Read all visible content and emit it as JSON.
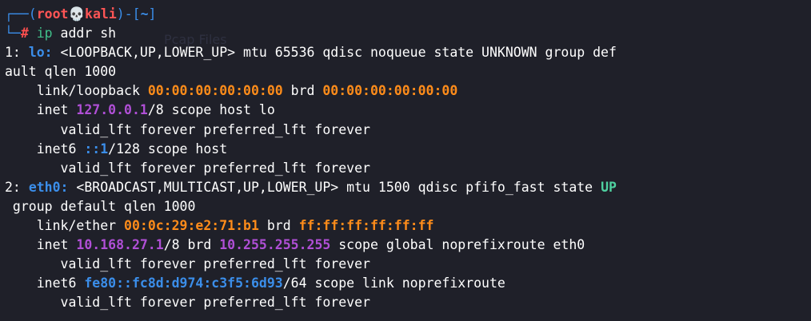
{
  "prompt": {
    "top_left": "┌──(",
    "user": "root",
    "skull": "💀",
    "host": "kali",
    "mid": ")-[",
    "path": "~",
    "end": "]",
    "bottom_left": "└─",
    "hash": "# ",
    "command": "ip",
    "args": " addr sh"
  },
  "ghost_text": "Pcap Files",
  "output": {
    "l1_pre": "1: ",
    "l1_if": "lo:",
    "l1_rest": " <LOOPBACK,UP,LOWER_UP> mtu 65536 qdisc noqueue state UNKNOWN group def",
    "l2": "ault qlen 1000",
    "l3_pre": "    link/loopback ",
    "l3_mac": "00:00:00:00:00:00",
    "l3_mid": " brd ",
    "l3_brd": "00:00:00:00:00:00",
    "l4_pre": "    inet ",
    "l4_ip": "127.0.0.1",
    "l4_rest": "/8 scope host lo",
    "l5": "       valid_lft forever preferred_lft forever",
    "l6_pre": "    inet6 ",
    "l6_ip": "::1",
    "l6_rest": "/128 scope host",
    "l7": "       valid_lft forever preferred_lft forever",
    "l8_pre": "2: ",
    "l8_if": "eth0:",
    "l8_rest": " <BROADCAST,MULTICAST,UP,LOWER_UP> mtu 1500 qdisc pfifo_fast state ",
    "l8_state": "UP",
    "l9": " group default qlen 1000",
    "l10_pre": "    link/ether ",
    "l10_mac": "00:0c:29:e2:71:b1",
    "l10_mid": " brd ",
    "l10_brd": "ff:ff:ff:ff:ff:ff",
    "l11_pre": "    inet ",
    "l11_ip": "10.168.27.1",
    "l11_mid": "/8 brd ",
    "l11_brd": "10.255.255.255",
    "l11_rest": " scope global noprefixroute eth0",
    "l12": "       valid_lft forever preferred_lft forever",
    "l13_pre": "    inet6 ",
    "l13_ip": "fe80::fc8d:d974:c3f5:6d93",
    "l13_rest": "/64 scope link noprefixroute",
    "l14": "       valid_lft forever preferred_lft forever"
  }
}
